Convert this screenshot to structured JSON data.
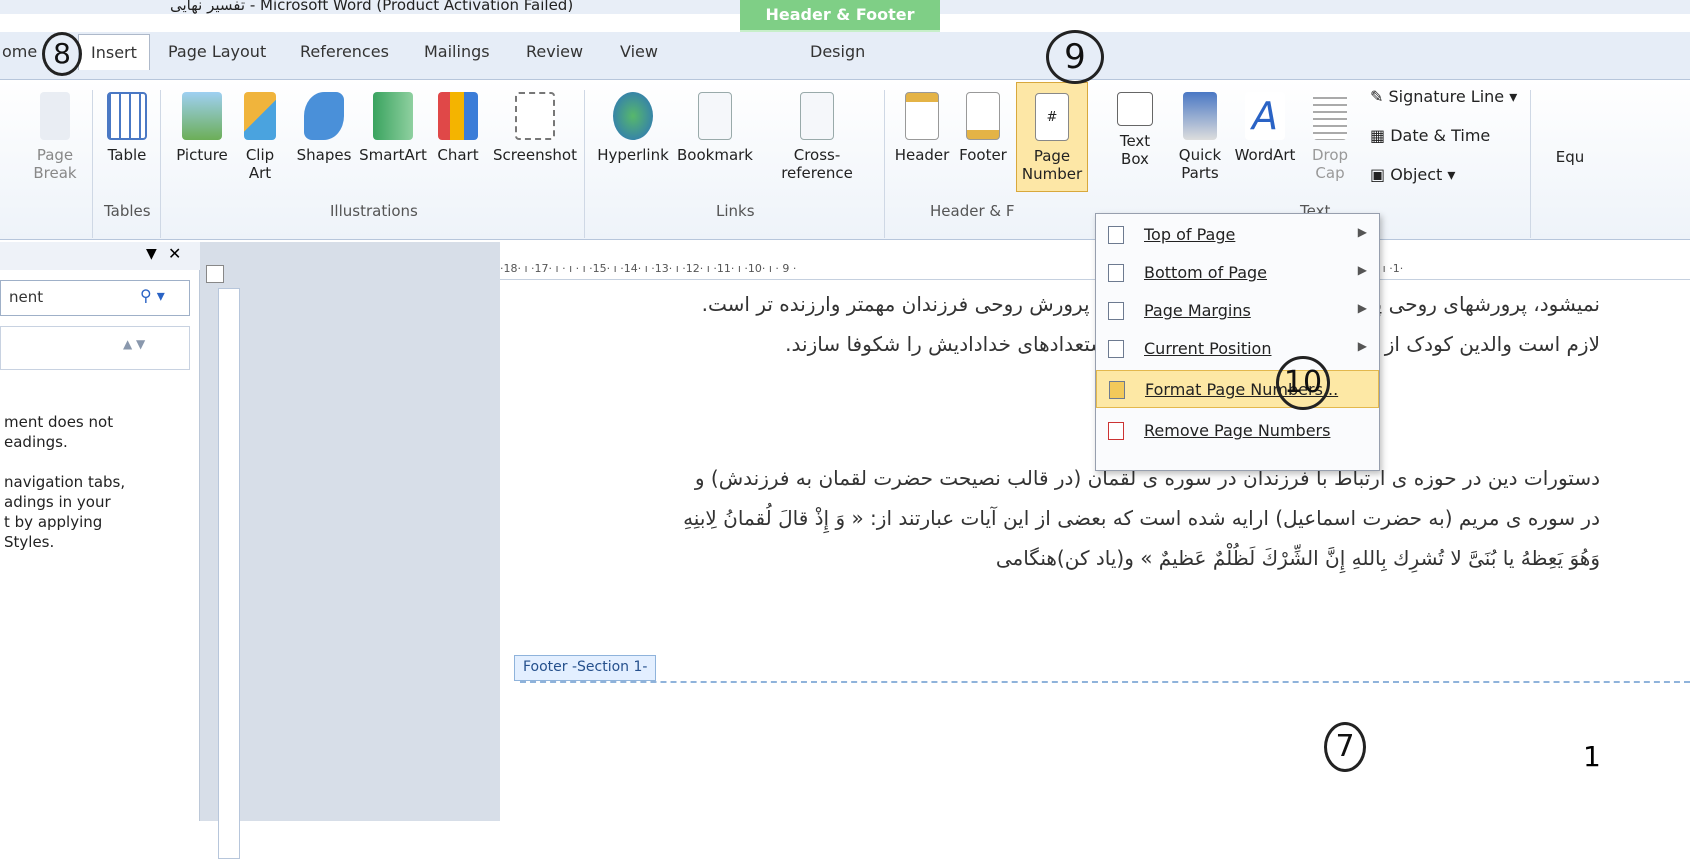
{
  "titlebar": {
    "title": "تفسیر نهایی - Microsoft Word (Product Activation Failed)",
    "context_header": "Header & Footer Tools"
  },
  "tabs": [
    "ome",
    "Insert",
    "Page Layout",
    "References",
    "Mailings",
    "Review",
    "View",
    "Design"
  ],
  "ribbon": {
    "buttons": [
      {
        "label": "Page\nBreak",
        "name": "page-break-button"
      },
      {
        "label": "Table",
        "name": "table-button"
      },
      {
        "label": "Picture",
        "name": "picture-button"
      },
      {
        "label": "Clip\nArt",
        "name": "clip-art-button"
      },
      {
        "label": "Shapes",
        "name": "shapes-button"
      },
      {
        "label": "SmartArt",
        "name": "smartart-button"
      },
      {
        "label": "Chart",
        "name": "chart-button"
      },
      {
        "label": "Screenshot",
        "name": "screenshot-button"
      },
      {
        "label": "Hyperlink",
        "name": "hyperlink-button"
      },
      {
        "label": "Bookmark",
        "name": "bookmark-button"
      },
      {
        "label": "Cross-reference",
        "name": "cross-reference-button"
      },
      {
        "label": "Header",
        "name": "header-button"
      },
      {
        "label": "Footer",
        "name": "footer-button"
      },
      {
        "label": "Page\nNumber",
        "name": "page-number-button"
      },
      {
        "label": "Text\nBox",
        "name": "text-box-button"
      },
      {
        "label": "Quick\nParts",
        "name": "quick-parts-button"
      },
      {
        "label": "WordArt",
        "name": "wordart-button"
      },
      {
        "label": "Drop\nCap",
        "name": "drop-cap-button"
      }
    ],
    "small": [
      "Signature Line",
      "Date & Time",
      "Object"
    ],
    "equation_partial": "Equ",
    "groups": [
      "Tables",
      "Illustrations",
      "Links",
      "Header & F",
      "Text"
    ]
  },
  "nav_pane": {
    "search_placeholder": "nent",
    "message": "ment does not\neadings.\n\nnavigation tabs,\nadings in your\nt by applying\nStyles."
  },
  "ruler_text": "·18· ı ·17· ı · ı · ı ·15· ı ·14· ı ·13· ı ·12· ı ·11· ı ·10· ı · 9 ·",
  "ruler_right": "· ı ·3· ı ·2· ı ·1· ı · ı ·1·",
  "document": {
    "paragraph1": "نمیشود، پرورشهای روحی پدر و مادر است. در اسلام تربیت و پرورش روحی فرزندان مهمتر وارزنده تر است. لازم است والدین کودک از همان روز اول انسان آشنا کنند واستعدادهای خدادادیش را شکوفا سازند.",
    "paragraph2": "دستورات دین در حوزه ی ارتباط با فرزندان در سوره ی لقمان (در قالب نصیحت حضرت لقمان به فرزندش) و در سوره ی مریم (به حضرت اسماعیل) ارایه شده است که بعضی از این آیات عبارتند از: « وَ إِذْ قالَ لُقمانُ لِابنِهِ وَهُوَ یَعِظهُ یا بُنَیَّ لا تُشرِك بِاللهِ إِنَّ الشِّرْكَ لَظُلْمٌ عَظیمٌ » و(یاد کن)هنگامی",
    "footer_tag": "Footer -Section 1-",
    "page_number": "1"
  },
  "page_number_menu": [
    "Top of Page",
    "Bottom of Page",
    "Page Margins",
    "Current Position",
    "Format Page Numbers...",
    "Remove Page Numbers"
  ],
  "annotations": [
    "8",
    "9",
    "10",
    "7"
  ]
}
